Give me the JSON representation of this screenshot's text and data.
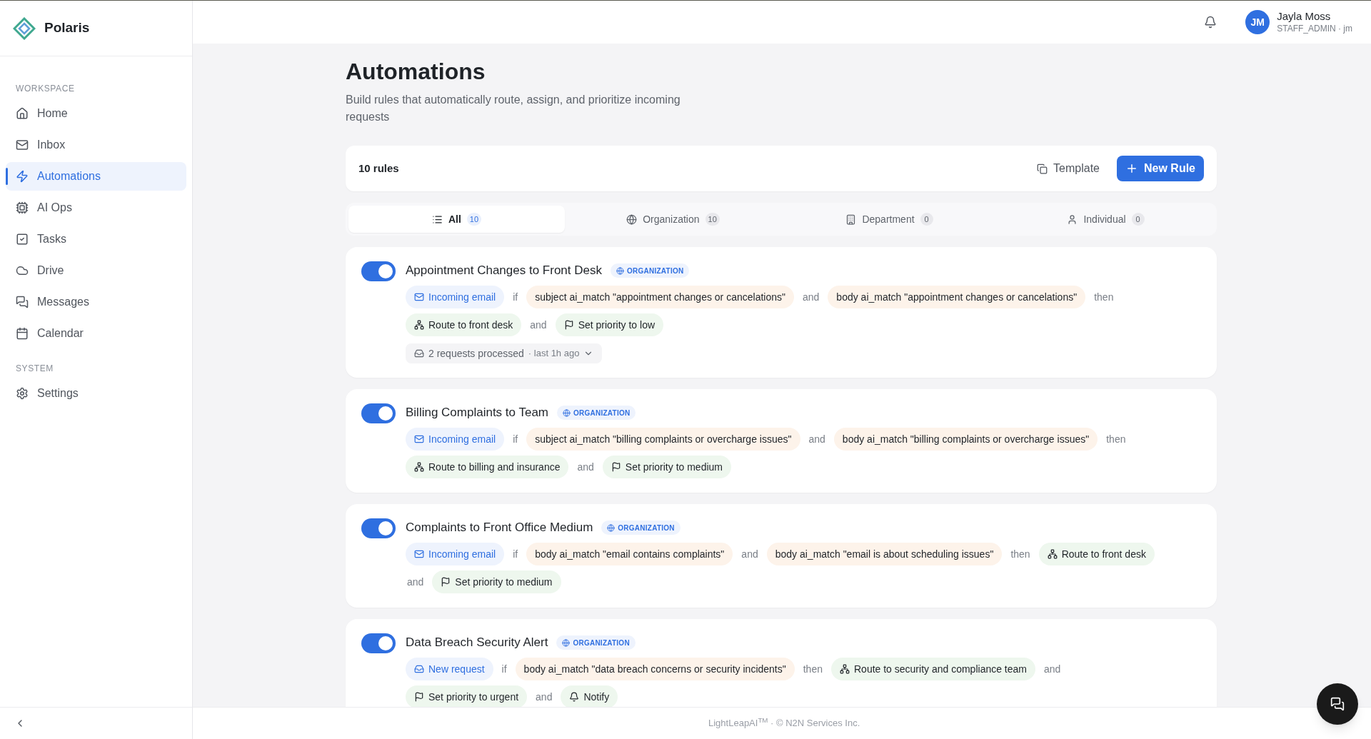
{
  "brand": {
    "name": "Polaris"
  },
  "sidebar": {
    "sections": [
      {
        "heading": "WORKSPACE",
        "items": [
          {
            "label": "Home",
            "selected": false
          },
          {
            "label": "Inbox",
            "selected": false
          },
          {
            "label": "Automations",
            "selected": true
          },
          {
            "label": "AI Ops",
            "selected": false
          },
          {
            "label": "Tasks",
            "selected": false
          },
          {
            "label": "Drive",
            "selected": false
          },
          {
            "label": "Messages",
            "selected": false
          },
          {
            "label": "Calendar",
            "selected": false
          }
        ]
      },
      {
        "heading": "SYSTEM",
        "items": [
          {
            "label": "Settings",
            "selected": false
          }
        ]
      }
    ]
  },
  "user": {
    "initials": "JM",
    "name": "Jayla Moss",
    "role": "STAFF_ADMIN · jm"
  },
  "page": {
    "title": "Automations",
    "subtitle": "Build rules that automatically route, assign, and prioritize incoming requests"
  },
  "toolbar": {
    "count": "10 rules",
    "template_button": "Template",
    "new_button": "New Rule"
  },
  "tabs": [
    {
      "label": "All",
      "count": "10",
      "selected": true
    },
    {
      "label": "Organization",
      "count": "10",
      "selected": false
    },
    {
      "label": "Department",
      "count": "0",
      "selected": false
    },
    {
      "label": "Individual",
      "count": "0",
      "selected": false
    }
  ],
  "rules": [
    {
      "name": "Appointment Changes to Front Desk",
      "on": true,
      "scope": "ORGANIZATION",
      "tokens": [
        {
          "kind": "email-trigger",
          "text": "Incoming email"
        },
        {
          "kind": "connector",
          "text": "if"
        },
        {
          "kind": "condition",
          "text": "subject ai_match \"appointment changes or cancelations\""
        },
        {
          "kind": "connector",
          "text": "and"
        },
        {
          "kind": "condition",
          "text": "body ai_match \"appointment changes or cancelations\""
        },
        {
          "kind": "connector",
          "text": "then"
        },
        {
          "kind": "break"
        },
        {
          "kind": "route-action",
          "text": "Route to front desk"
        },
        {
          "kind": "connector",
          "text": "and"
        },
        {
          "kind": "priority-action",
          "text": "Set priority to low"
        }
      ],
      "activity": {
        "count": "2 requests processed",
        "time": "· last 1h ago"
      }
    },
    {
      "name": "Billing Complaints to Team",
      "on": true,
      "scope": "ORGANIZATION",
      "tokens": [
        {
          "kind": "email-trigger",
          "text": "Incoming email"
        },
        {
          "kind": "connector",
          "text": "if"
        },
        {
          "kind": "condition",
          "text": "subject ai_match \"billing complaints or overcharge issues\""
        },
        {
          "kind": "connector",
          "text": "and"
        },
        {
          "kind": "condition",
          "text": "body ai_match \"billing complaints or overcharge issues\""
        },
        {
          "kind": "connector",
          "text": "then"
        },
        {
          "kind": "break"
        },
        {
          "kind": "route-action",
          "text": "Route to billing and insurance"
        },
        {
          "kind": "connector",
          "text": "and"
        },
        {
          "kind": "priority-action",
          "text": "Set priority to medium"
        }
      ]
    },
    {
      "name": "Complaints to Front Office Medium",
      "on": true,
      "scope": "ORGANIZATION",
      "tokens": [
        {
          "kind": "email-trigger",
          "text": "Incoming email"
        },
        {
          "kind": "connector",
          "text": "if"
        },
        {
          "kind": "condition",
          "text": "body ai_match \"email contains complaints\""
        },
        {
          "kind": "connector",
          "text": "and"
        },
        {
          "kind": "condition",
          "text": "body ai_match \"email is about scheduling issues\""
        },
        {
          "kind": "connector",
          "text": "then"
        },
        {
          "kind": "route-action",
          "text": "Route to front desk"
        },
        {
          "kind": "break"
        },
        {
          "kind": "connector",
          "text": "and"
        },
        {
          "kind": "priority-action",
          "text": "Set priority to medium"
        }
      ]
    },
    {
      "name": "Data Breach Security Alert",
      "on": true,
      "scope": "ORGANIZATION",
      "tokens": [
        {
          "kind": "request-trigger",
          "text": "New request"
        },
        {
          "kind": "connector",
          "text": "if"
        },
        {
          "kind": "condition",
          "text": "body ai_match \"data breach concerns or security incidents\""
        },
        {
          "kind": "connector",
          "text": "then"
        },
        {
          "kind": "route-action",
          "text": "Route to security and compliance team"
        },
        {
          "kind": "connector",
          "text": "and"
        },
        {
          "kind": "break"
        },
        {
          "kind": "priority-action",
          "text": "Set priority to urgent"
        },
        {
          "kind": "connector",
          "text": "and"
        },
        {
          "kind": "notify-action",
          "text": "Notify"
        }
      ]
    }
  ],
  "footer": {
    "text": "LightLeapAI$^{TM}$ · © N2N Services Inc."
  }
}
